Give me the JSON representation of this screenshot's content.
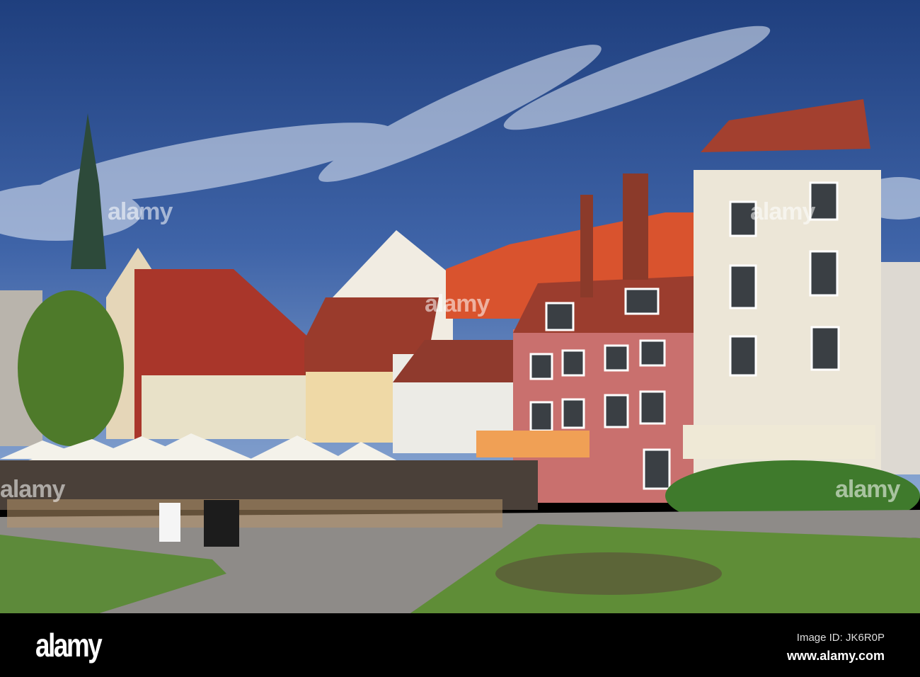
{
  "photo": {
    "subject": "Old town square with colorful buildings and cafe terrace"
  },
  "watermark": {
    "text": "alamy"
  },
  "footer": {
    "logo": "alamy",
    "image_id": "Image ID: JK6R0P",
    "url": "www.alamy.com"
  },
  "colors": {
    "sky": "#2f4f8f",
    "lawn": "#5d8a3a",
    "pink_building": "#c9706e",
    "roof": "#d9532e"
  }
}
